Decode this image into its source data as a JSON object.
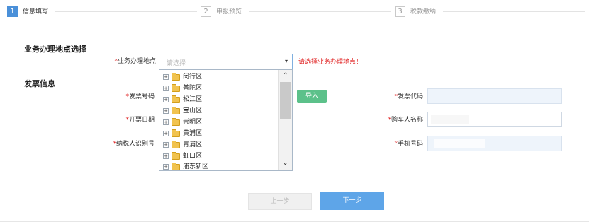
{
  "steps": [
    {
      "num": "1",
      "label": "信息填写"
    },
    {
      "num": "2",
      "label": "申报预览"
    },
    {
      "num": "3",
      "label": "税款缴纳"
    }
  ],
  "location_section": {
    "title": "业务办理地点选择",
    "label": "业务办理地点",
    "required_mark": "*",
    "select_placeholder": "请选择",
    "error": "请选择业务办理地点！"
  },
  "dropdown": {
    "items": [
      "闵行区",
      "普陀区",
      "松江区",
      "宝山区",
      "崇明区",
      "黄浦区",
      "青浦区",
      "虹口区",
      "浦东新区"
    ]
  },
  "invoice_section": {
    "title": "发票信息",
    "required_mark": "*",
    "fields": {
      "invoice_number": {
        "label": "发票号码"
      },
      "invoice_code": {
        "label": "发票代码"
      },
      "issue_date": {
        "label": "开票日期"
      },
      "buyer_name": {
        "label": "购车人名称"
      },
      "taxpayer_id": {
        "label": "纳税人识别号"
      },
      "phone": {
        "label": "手机号码"
      }
    },
    "import_button": "导入"
  },
  "nav": {
    "prev": "上一步",
    "next": "下一步"
  }
}
